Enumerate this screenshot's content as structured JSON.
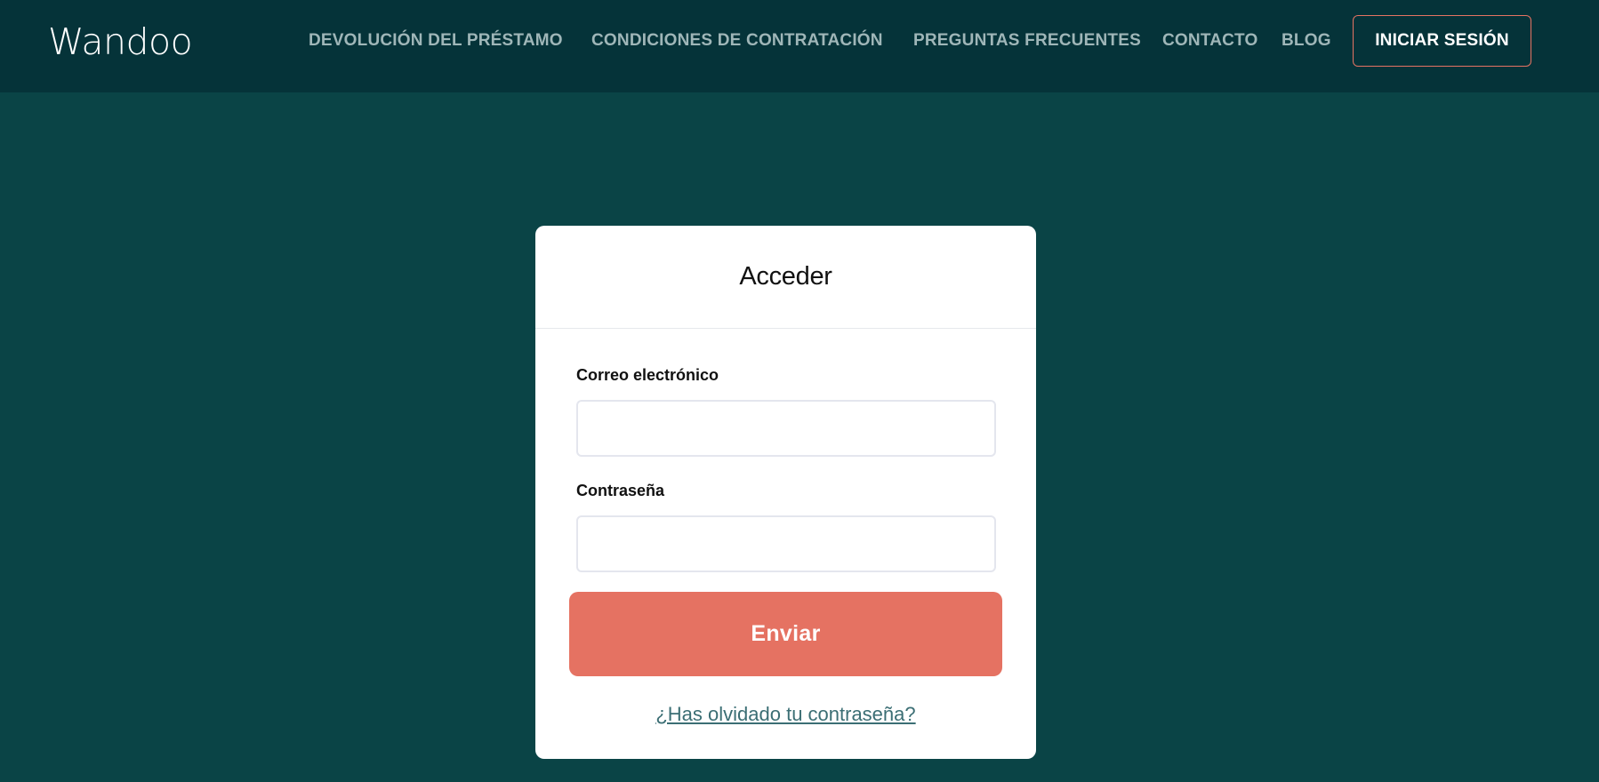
{
  "header": {
    "logo_text": "Wandoo",
    "nav": [
      {
        "label": "DEVOLUCIÓN DEL PRÉSTAMO"
      },
      {
        "label": "CONDICIONES DE CONTRATACIÓN"
      },
      {
        "label": "PREGUNTAS FRECUENTES"
      },
      {
        "label": "CONTACTO"
      },
      {
        "label": "BLOG"
      }
    ],
    "login_label": "INICIAR SESIÓN"
  },
  "login_form": {
    "title": "Acceder",
    "email_label": "Correo electrónico",
    "email_value": "",
    "password_label": "Contraseña",
    "password_value": "",
    "submit_label": "Enviar",
    "forgot_label": "¿Has olvidado tu contraseña?"
  },
  "colors": {
    "header_bg": "#053339",
    "page_bg": "#0a4446",
    "accent": "#e57262",
    "nav_text": "#9fb6b8",
    "link": "#3b6e74"
  }
}
